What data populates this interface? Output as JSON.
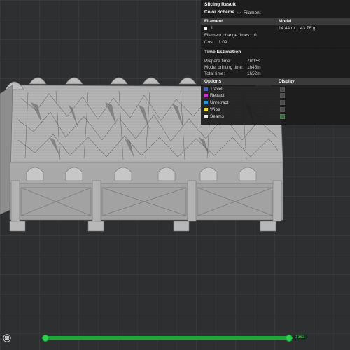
{
  "panel": {
    "title": "Slicing Result",
    "color_scheme_label": "Color Scheme",
    "color_scheme_value": "Filament",
    "filament_header": "Filament",
    "model_header": "Model",
    "filament_id": "1",
    "filament_length": "14.44 m",
    "filament_weight": "43.76 g",
    "filament_color": "#f2f2f2",
    "change_times_label": "Filament change times:",
    "change_times_value": "0",
    "cost_label": "Cost:",
    "cost_value": "1.09",
    "time_title": "Time Estimation",
    "prepare_label": "Prepare time:",
    "prepare_value": "7m15s",
    "model_time_label": "Model printing time:",
    "model_time_value": "1h45m",
    "total_label": "Total time:",
    "total_value": "1h52m",
    "options_header": "Options",
    "display_header": "Display",
    "options": [
      {
        "label": "Travel",
        "color": "#3c5cd0",
        "display": false
      },
      {
        "label": "Retract",
        "color": "#c23cc8",
        "display": false
      },
      {
        "label": "Unretract",
        "color": "#2a9ad0",
        "display": false
      },
      {
        "label": "Wipe",
        "color": "#e8e02a",
        "display": false
      },
      {
        "label": "Seams",
        "color": "#e6e6e6",
        "display": true
      }
    ]
  },
  "bottom": {
    "layer_value": "1363",
    "accent": "#1fa83a",
    "layer_range_fraction": 1.0
  },
  "viewport": {
    "background": "#2e2f31",
    "model_color": "#a5a5a5"
  }
}
